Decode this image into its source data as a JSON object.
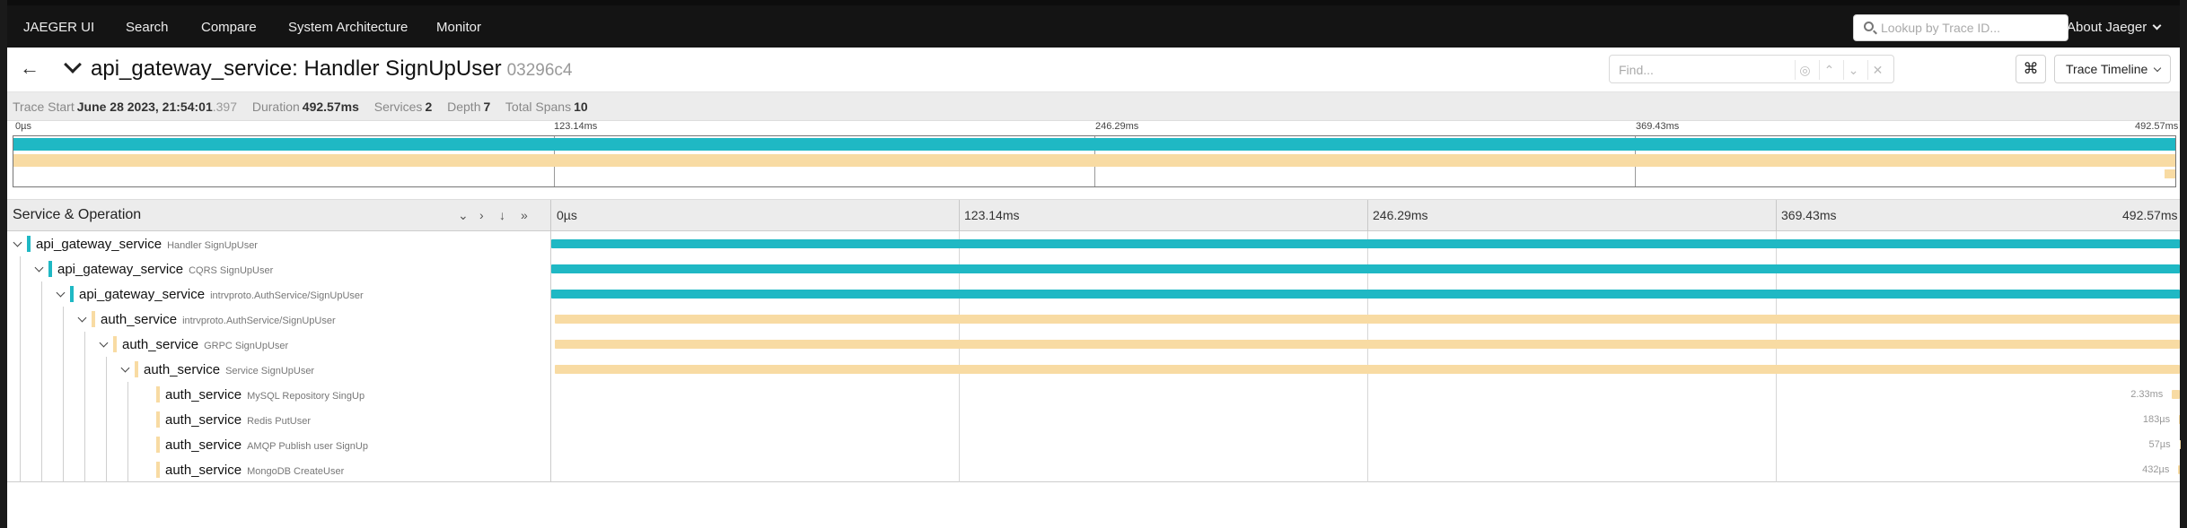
{
  "nav": {
    "brand": "JAEGER UI",
    "items": [
      "Search",
      "Compare",
      "System Architecture",
      "Monitor"
    ],
    "lookup_placeholder": "Lookup by Trace ID...",
    "about": "About Jaeger"
  },
  "trace": {
    "title": "api_gateway_service: Handler SignUpUser",
    "id": "03296c4",
    "find_placeholder": "Find...",
    "view_mode": "Trace Timeline",
    "back_icon": "arrow-left-icon",
    "keyboard_icon": "command-icon"
  },
  "summary": {
    "trace_start_label": "Trace Start",
    "trace_start_value": "June 28 2023, 21:54:01",
    "trace_start_ms": ".397",
    "duration_label": "Duration",
    "duration_value": "492.57ms",
    "services_label": "Services",
    "services_value": "2",
    "depth_label": "Depth",
    "depth_value": "7",
    "total_spans_label": "Total Spans",
    "total_spans_value": "10"
  },
  "ticks": [
    "0µs",
    "123.14ms",
    "246.29ms",
    "369.43ms",
    "492.57ms"
  ],
  "timeline_header": {
    "title": "Service & Operation"
  },
  "colors": {
    "api_gateway_service": "#1fb8c4",
    "auth_service": "#f8dba3"
  },
  "spans": [
    {
      "service": "api_gateway_service",
      "operation": "Handler SignUpUser",
      "depth": 0,
      "start": 0.0,
      "end": 1.0,
      "duration": ""
    },
    {
      "service": "api_gateway_service",
      "operation": "CQRS SignUpUser",
      "depth": 1,
      "start": 0.0,
      "end": 1.0,
      "duration": ""
    },
    {
      "service": "api_gateway_service",
      "operation": "intrvproto.AuthService/SignUpUser",
      "depth": 2,
      "start": 0.0,
      "end": 1.0,
      "duration": ""
    },
    {
      "service": "auth_service",
      "operation": "intrvproto.AuthService/SignUpUser",
      "depth": 3,
      "start": 0.002,
      "end": 1.0,
      "duration": ""
    },
    {
      "service": "auth_service",
      "operation": "GRPC SignUpUser",
      "depth": 4,
      "start": 0.002,
      "end": 1.0,
      "duration": ""
    },
    {
      "service": "auth_service",
      "operation": "Service SignUpUser",
      "depth": 5,
      "start": 0.002,
      "end": 1.0,
      "duration": ""
    },
    {
      "service": "auth_service",
      "operation": "MySQL Repository SingUp",
      "depth": 6,
      "start": 0.9952,
      "end": 1.0,
      "duration": "2.33ms"
    },
    {
      "service": "auth_service",
      "operation": "Redis PutUser",
      "depth": 6,
      "start": 0.9995,
      "end": 1.0,
      "duration": "183µs"
    },
    {
      "service": "auth_service",
      "operation": "AMQP Publish user SignUp",
      "depth": 6,
      "start": 0.9998,
      "end": 1.0,
      "duration": "57µs"
    },
    {
      "service": "auth_service",
      "operation": "MongoDB CreateUser",
      "depth": 6,
      "start": 0.9991,
      "end": 1.0,
      "duration": "432µs"
    }
  ]
}
